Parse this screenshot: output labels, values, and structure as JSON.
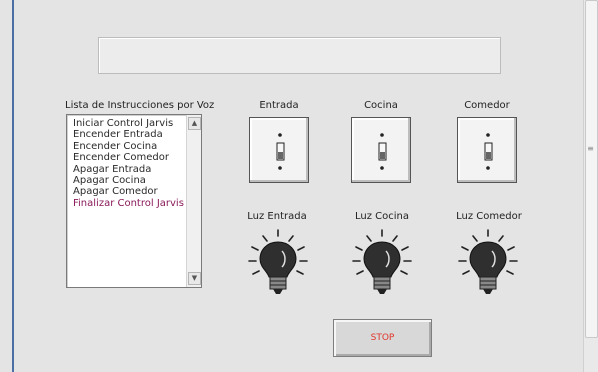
{
  "list": {
    "label": "Lista de Instrucciones por Voz",
    "items": [
      "Iniciar Control Jarvis",
      "Encender Entrada",
      "Encender Cocina",
      "Encender Comedor",
      "Apagar Entrada",
      "Apagar Cocina",
      "Apagar Comedor",
      "Finalizar Control Jarvis"
    ]
  },
  "switches": [
    {
      "label": "Entrada",
      "state": "off"
    },
    {
      "label": "Cocina",
      "state": "off"
    },
    {
      "label": "Comedor",
      "state": "off"
    }
  ],
  "lights": [
    {
      "label": "Luz Entrada",
      "state": "off"
    },
    {
      "label": "Luz Cocina",
      "state": "off"
    },
    {
      "label": "Luz Comedor",
      "state": "off"
    }
  ],
  "stop_button": {
    "label": "STOP",
    "color": "#e0362a"
  },
  "colors": {
    "background": "#e4e4e4",
    "window_border": "#4b6ea4",
    "bulb": "#333333"
  },
  "icons": {
    "switch": "toggle-switch-icon",
    "light": "light-bulb-icon"
  }
}
